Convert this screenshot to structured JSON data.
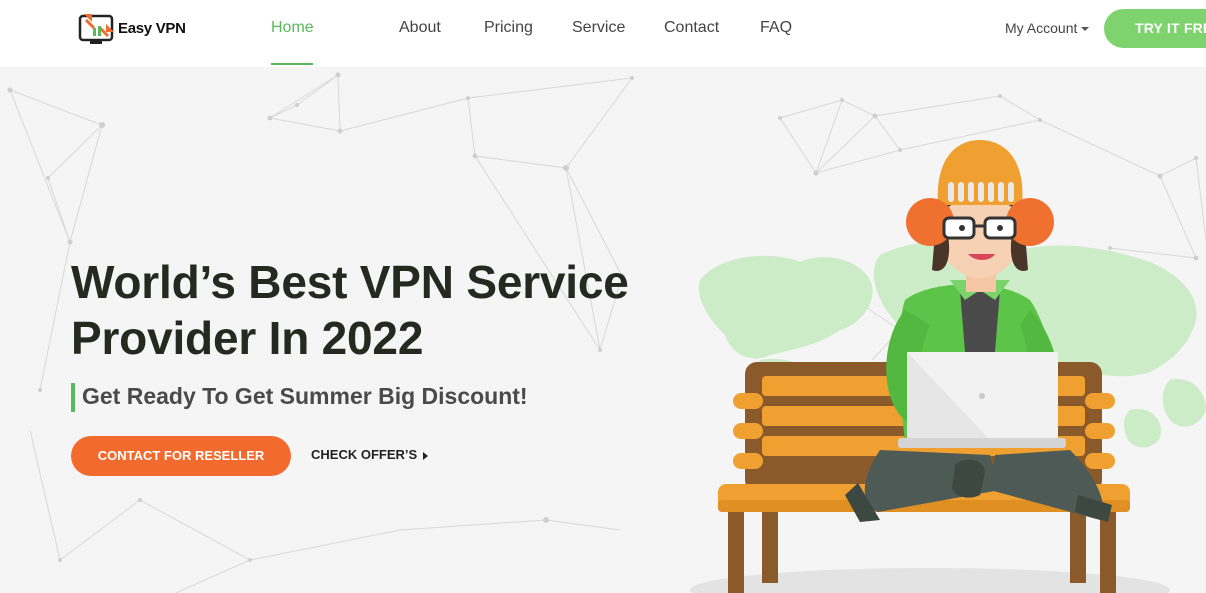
{
  "brand": {
    "name": "Easy VPN",
    "icon": "monitor-logo-icon"
  },
  "nav": {
    "items": [
      {
        "label": "Home",
        "active": true
      },
      {
        "label": "About"
      },
      {
        "label": "Pricing"
      },
      {
        "label": "Service"
      },
      {
        "label": "Contact"
      },
      {
        "label": "FAQ"
      }
    ],
    "account_label": "My Account",
    "try_label": "TRY IT FREE"
  },
  "hero": {
    "title_line1": "World’s Best VPN Service",
    "title_line2": "Provider In 2022",
    "subtitle": "Get Ready To Get Summer Big Discount!",
    "cta_label": "CONTACT FOR RESELLER",
    "offer_label": "CHECK OFFER’S"
  },
  "colors": {
    "accent_green": "#5cb85c",
    "button_green": "#7ed36e",
    "cta_orange": "#f36a2f",
    "heading": "#25291f",
    "background": "#f5f5f5"
  }
}
